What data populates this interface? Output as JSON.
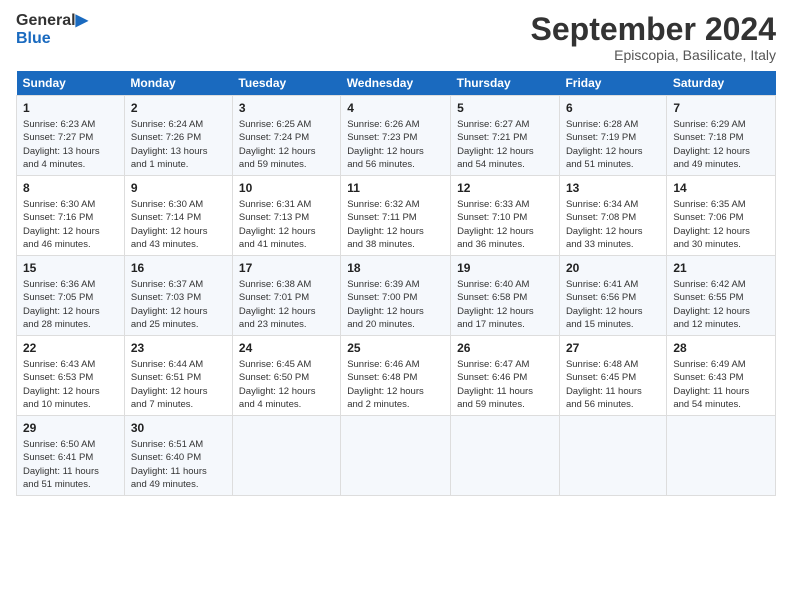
{
  "header": {
    "logo_line1": "General",
    "logo_line2": "Blue",
    "month": "September 2024",
    "location": "Episcopia, Basilicate, Italy"
  },
  "days_of_week": [
    "Sunday",
    "Monday",
    "Tuesday",
    "Wednesday",
    "Thursday",
    "Friday",
    "Saturday"
  ],
  "weeks": [
    [
      {
        "day": "1",
        "info": "Sunrise: 6:23 AM\nSunset: 7:27 PM\nDaylight: 13 hours\nand 4 minutes."
      },
      {
        "day": "2",
        "info": "Sunrise: 6:24 AM\nSunset: 7:26 PM\nDaylight: 13 hours\nand 1 minute."
      },
      {
        "day": "3",
        "info": "Sunrise: 6:25 AM\nSunset: 7:24 PM\nDaylight: 12 hours\nand 59 minutes."
      },
      {
        "day": "4",
        "info": "Sunrise: 6:26 AM\nSunset: 7:23 PM\nDaylight: 12 hours\nand 56 minutes."
      },
      {
        "day": "5",
        "info": "Sunrise: 6:27 AM\nSunset: 7:21 PM\nDaylight: 12 hours\nand 54 minutes."
      },
      {
        "day": "6",
        "info": "Sunrise: 6:28 AM\nSunset: 7:19 PM\nDaylight: 12 hours\nand 51 minutes."
      },
      {
        "day": "7",
        "info": "Sunrise: 6:29 AM\nSunset: 7:18 PM\nDaylight: 12 hours\nand 49 minutes."
      }
    ],
    [
      {
        "day": "8",
        "info": "Sunrise: 6:30 AM\nSunset: 7:16 PM\nDaylight: 12 hours\nand 46 minutes."
      },
      {
        "day": "9",
        "info": "Sunrise: 6:30 AM\nSunset: 7:14 PM\nDaylight: 12 hours\nand 43 minutes."
      },
      {
        "day": "10",
        "info": "Sunrise: 6:31 AM\nSunset: 7:13 PM\nDaylight: 12 hours\nand 41 minutes."
      },
      {
        "day": "11",
        "info": "Sunrise: 6:32 AM\nSunset: 7:11 PM\nDaylight: 12 hours\nand 38 minutes."
      },
      {
        "day": "12",
        "info": "Sunrise: 6:33 AM\nSunset: 7:10 PM\nDaylight: 12 hours\nand 36 minutes."
      },
      {
        "day": "13",
        "info": "Sunrise: 6:34 AM\nSunset: 7:08 PM\nDaylight: 12 hours\nand 33 minutes."
      },
      {
        "day": "14",
        "info": "Sunrise: 6:35 AM\nSunset: 7:06 PM\nDaylight: 12 hours\nand 30 minutes."
      }
    ],
    [
      {
        "day": "15",
        "info": "Sunrise: 6:36 AM\nSunset: 7:05 PM\nDaylight: 12 hours\nand 28 minutes."
      },
      {
        "day": "16",
        "info": "Sunrise: 6:37 AM\nSunset: 7:03 PM\nDaylight: 12 hours\nand 25 minutes."
      },
      {
        "day": "17",
        "info": "Sunrise: 6:38 AM\nSunset: 7:01 PM\nDaylight: 12 hours\nand 23 minutes."
      },
      {
        "day": "18",
        "info": "Sunrise: 6:39 AM\nSunset: 7:00 PM\nDaylight: 12 hours\nand 20 minutes."
      },
      {
        "day": "19",
        "info": "Sunrise: 6:40 AM\nSunset: 6:58 PM\nDaylight: 12 hours\nand 17 minutes."
      },
      {
        "day": "20",
        "info": "Sunrise: 6:41 AM\nSunset: 6:56 PM\nDaylight: 12 hours\nand 15 minutes."
      },
      {
        "day": "21",
        "info": "Sunrise: 6:42 AM\nSunset: 6:55 PM\nDaylight: 12 hours\nand 12 minutes."
      }
    ],
    [
      {
        "day": "22",
        "info": "Sunrise: 6:43 AM\nSunset: 6:53 PM\nDaylight: 12 hours\nand 10 minutes."
      },
      {
        "day": "23",
        "info": "Sunrise: 6:44 AM\nSunset: 6:51 PM\nDaylight: 12 hours\nand 7 minutes."
      },
      {
        "day": "24",
        "info": "Sunrise: 6:45 AM\nSunset: 6:50 PM\nDaylight: 12 hours\nand 4 minutes."
      },
      {
        "day": "25",
        "info": "Sunrise: 6:46 AM\nSunset: 6:48 PM\nDaylight: 12 hours\nand 2 minutes."
      },
      {
        "day": "26",
        "info": "Sunrise: 6:47 AM\nSunset: 6:46 PM\nDaylight: 11 hours\nand 59 minutes."
      },
      {
        "day": "27",
        "info": "Sunrise: 6:48 AM\nSunset: 6:45 PM\nDaylight: 11 hours\nand 56 minutes."
      },
      {
        "day": "28",
        "info": "Sunrise: 6:49 AM\nSunset: 6:43 PM\nDaylight: 11 hours\nand 54 minutes."
      }
    ],
    [
      {
        "day": "29",
        "info": "Sunrise: 6:50 AM\nSunset: 6:41 PM\nDaylight: 11 hours\nand 51 minutes."
      },
      {
        "day": "30",
        "info": "Sunrise: 6:51 AM\nSunset: 6:40 PM\nDaylight: 11 hours\nand 49 minutes."
      },
      {
        "day": "",
        "info": ""
      },
      {
        "day": "",
        "info": ""
      },
      {
        "day": "",
        "info": ""
      },
      {
        "day": "",
        "info": ""
      },
      {
        "day": "",
        "info": ""
      }
    ]
  ]
}
